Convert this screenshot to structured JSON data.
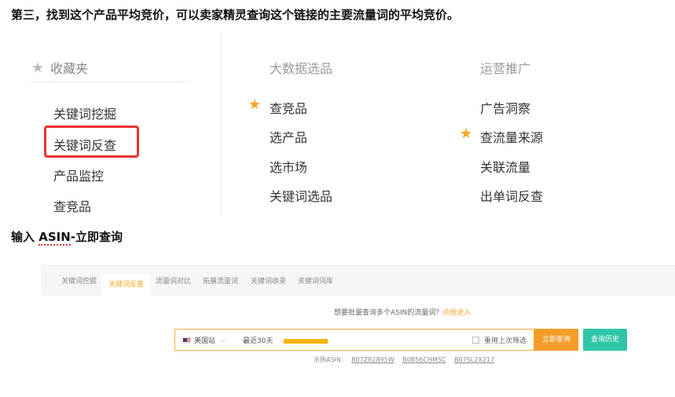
{
  "headings": {
    "step3": "第三，找到这个产品平均竞价，可以卖家精灵查询这个链接的主要流量词的平均竞价。",
    "step_input_prefix": "输入 ",
    "step_input_asin": "ASIN",
    "step_input_suffix": "-立即查询"
  },
  "menu": {
    "favorites": {
      "title": "收藏夹",
      "icon": "star-icon",
      "items": [
        "关键词挖掘",
        "关键词反查",
        "产品监控",
        "查竞品"
      ]
    },
    "big_data": {
      "title": "大数据选品",
      "items": [
        "查竞品",
        "选产品",
        "选市场",
        "关键词选品"
      ]
    },
    "operations": {
      "title": "运营推广",
      "items": [
        "广告洞察",
        "查流量来源",
        "关联流量",
        "出单词反查"
      ]
    },
    "highlight_color": "#e8322f",
    "star_color": "#f5a623"
  },
  "tool": {
    "tabs": [
      "关键词挖掘",
      "关键词反查",
      "流量词对比",
      "拓展流量词",
      "关键词收录",
      "关键词词库"
    ],
    "active_tab": "关键词反查",
    "hint_text": "想要批量查询多个ASIN的流量词？",
    "hint_link": "点我进入",
    "site": "美国站",
    "period": "最近30天",
    "reuse_filter": "重用上次筛选",
    "query_button": "立即查询",
    "history_button": "查询历史",
    "examples_label": "示例ASIN:",
    "examples": [
      "B07Z82895W",
      "B0B56CHMSC",
      "B07SL2X217"
    ],
    "accent_color": "#f59d2a",
    "history_color": "#2ec6a7"
  }
}
